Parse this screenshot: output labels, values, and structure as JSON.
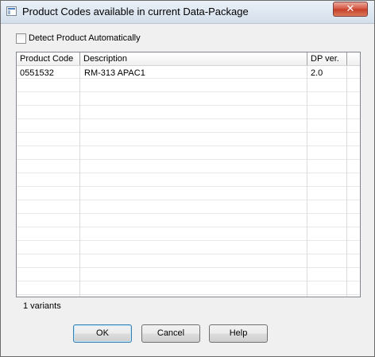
{
  "window": {
    "title": "Product Codes available in current Data-Package",
    "close_glyph": "✕"
  },
  "detect": {
    "label": "Detect Product Automatically",
    "checked": false
  },
  "table": {
    "headers": [
      "Product Code",
      "Description",
      "DP ver."
    ],
    "rows": [
      [
        "0551532",
        "RM-313 APAC1",
        "2.0"
      ]
    ]
  },
  "status": {
    "text": "1 variants"
  },
  "buttons": {
    "ok": "OK",
    "cancel": "Cancel",
    "help": "Help"
  },
  "colors": {
    "title_bar": "#d4dfec",
    "close_button": "#c43d27",
    "dialog_bg": "#f0f0f0",
    "grid_bg": "#ffffff"
  },
  "icons": [
    "app-icon",
    "close-icon",
    "checkbox-icon"
  ]
}
